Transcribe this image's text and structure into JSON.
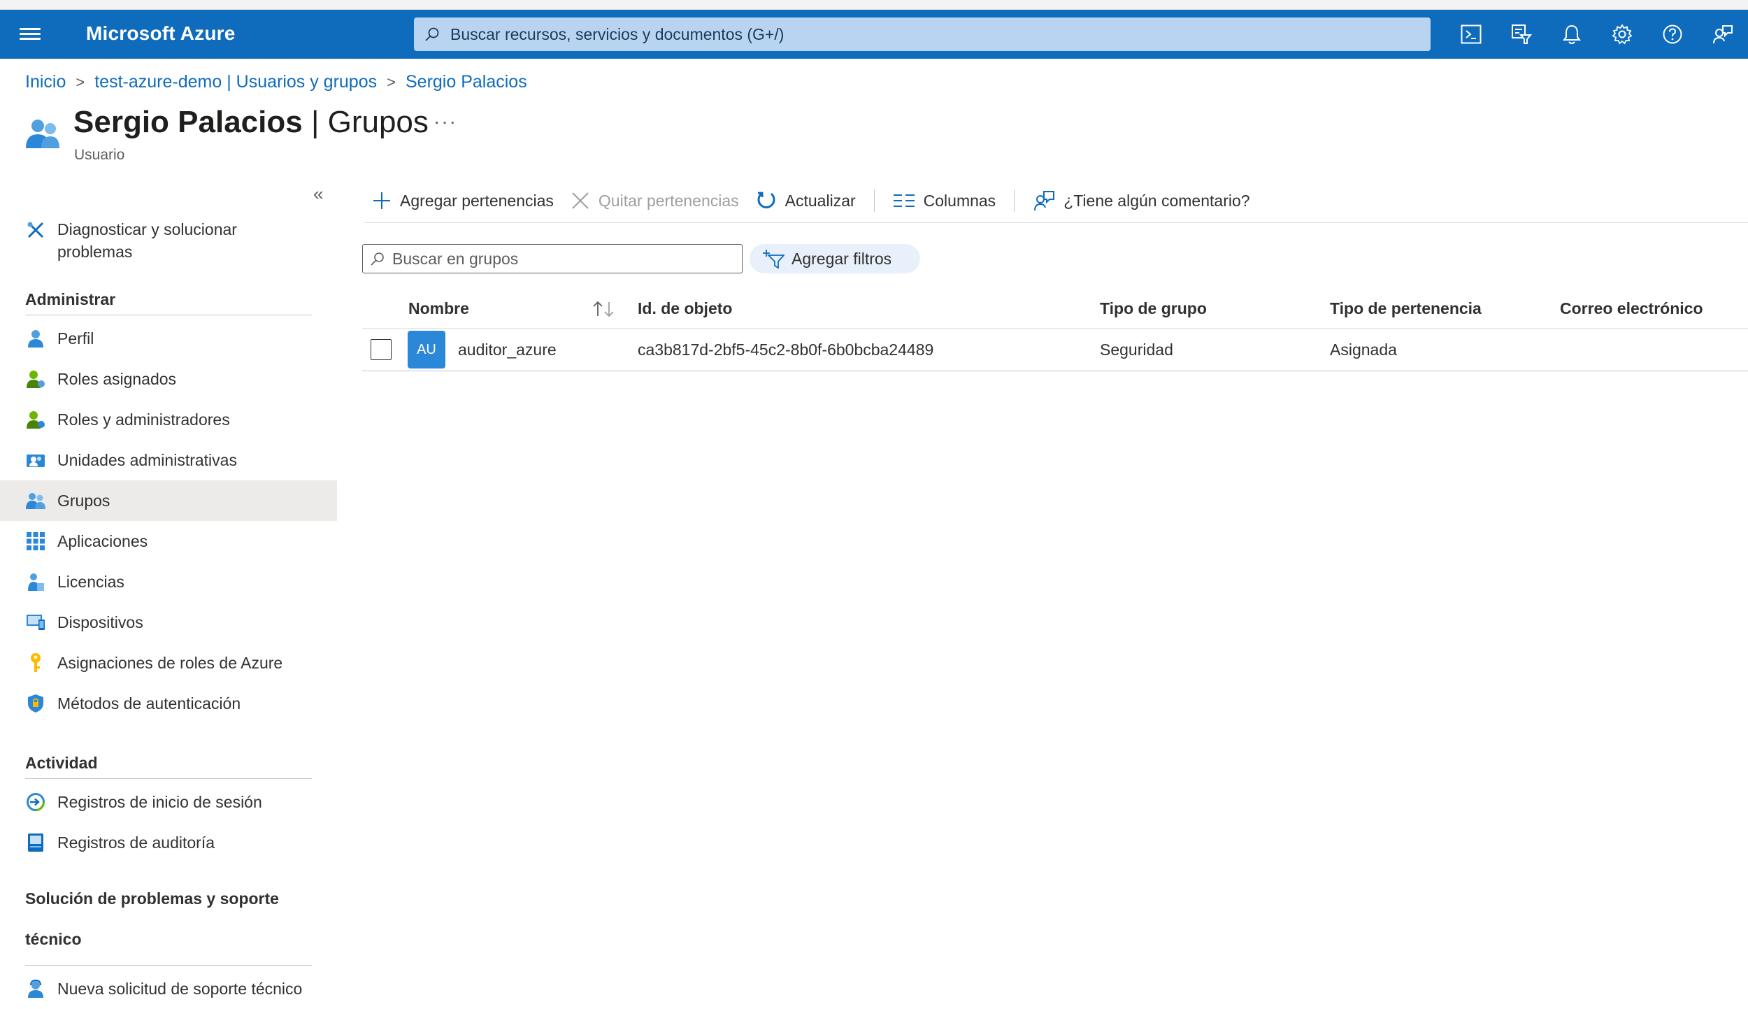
{
  "topbar": {
    "brand": "Microsoft Azure",
    "search_placeholder": "Buscar recursos, servicios y documentos (G+/)",
    "icons": [
      "cloud-shell-icon",
      "directory-filter-icon",
      "bell-icon",
      "gear-icon",
      "help-icon",
      "feedback-icon"
    ]
  },
  "breadcrumb": [
    "Inicio",
    "test-azure-demo | Usuarios y grupos",
    "Sergio Palacios"
  ],
  "page": {
    "title_name": "Sergio Palacios",
    "title_section": "| Grupos",
    "subtitle": "Usuario",
    "more": "···",
    "collapse": "«"
  },
  "sidebar": {
    "top_item": "Diagnosticar y solucionar problemas",
    "sections": [
      {
        "title": "Administrar",
        "items": [
          "Perfil",
          "Roles asignados",
          "Roles y administradores",
          "Unidades administrativas",
          "Grupos",
          "Aplicaciones",
          "Licencias",
          "Dispositivos",
          "Asignaciones de roles de Azure",
          "Métodos de autenticación"
        ]
      },
      {
        "title": "Actividad",
        "items": [
          "Registros de inicio de sesión",
          "Registros de auditoría"
        ]
      },
      {
        "title": "Solución de problemas y soporte técnico",
        "items": [
          "Nueva solicitud de soporte técnico"
        ]
      }
    ],
    "active": "Grupos"
  },
  "toolbar": {
    "add": "Agregar pertenencias",
    "remove": "Quitar pertenencias",
    "refresh": "Actualizar",
    "columns": "Columnas",
    "feedback": "¿Tiene algún comentario?"
  },
  "filters": {
    "search_placeholder": "Buscar en grupos",
    "add_filters": "Agregar filtros"
  },
  "table": {
    "columns": [
      "Nombre",
      "Id. de objeto",
      "Tipo de grupo",
      "Tipo de pertenencia",
      "Correo electrónico"
    ],
    "rows": [
      {
        "initials": "AU",
        "name": "auditor_azure",
        "object_id": "ca3b817d-2bf5-45c2-8b0f-6b0bcba24489",
        "group_type": "Seguridad",
        "membership_type": "Asignada",
        "email": ""
      }
    ]
  },
  "colors": {
    "brand_blue": "#0f6cbd",
    "search_bg": "#b8d4f1",
    "active_nav": "#edebe9",
    "avatar_blue": "#2b88d8"
  }
}
